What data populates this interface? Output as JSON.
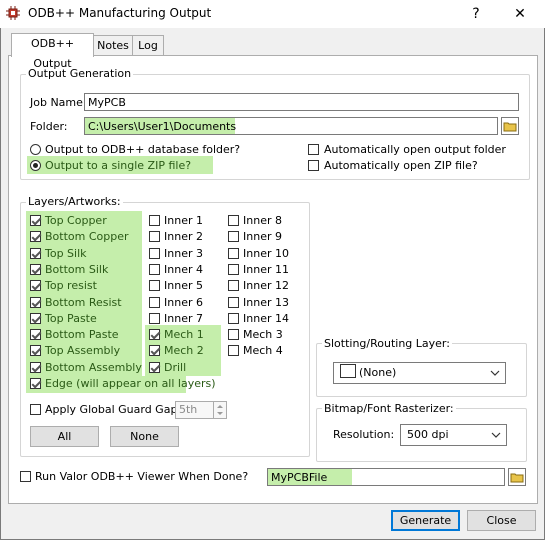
{
  "window": {
    "title": "ODB++ Manufacturing Output",
    "help_label": "?",
    "close_label": "✕"
  },
  "tabs": [
    {
      "label": "ODB++ Output",
      "active": true
    },
    {
      "label": "Notes"
    },
    {
      "label": "Log"
    }
  ],
  "output_generation": {
    "group_label": "Output Generation",
    "job_name_label": "Job Name:",
    "job_name_value": "MyPCB",
    "folder_label": "Folder:",
    "folder_value": "C:\\Users\\User1\\Documents",
    "radio_database": "Output to ODB++ database folder?",
    "radio_zip": "Output to a single ZIP file?",
    "auto_open_folder": "Automatically open output folder",
    "auto_open_zip": "Automatically open ZIP file?"
  },
  "layers": {
    "group_label": "Layers/Artworks:",
    "column1": [
      {
        "label": "Top Copper",
        "checked": true
      },
      {
        "label": "Bottom Copper",
        "checked": true
      },
      {
        "label": "Top Silk",
        "checked": true
      },
      {
        "label": "Bottom Silk",
        "checked": true
      },
      {
        "label": "Top resist",
        "checked": true
      },
      {
        "label": "Bottom Resist",
        "checked": true
      },
      {
        "label": "Top Paste",
        "checked": true
      },
      {
        "label": "Bottom Paste",
        "checked": true
      },
      {
        "label": "Top Assembly",
        "checked": true
      },
      {
        "label": "Bottom Assembly",
        "checked": true
      }
    ],
    "column2": [
      {
        "label": "Inner 1",
        "checked": false
      },
      {
        "label": "Inner 2",
        "checked": false
      },
      {
        "label": "Inner 3",
        "checked": false
      },
      {
        "label": "Inner 4",
        "checked": false
      },
      {
        "label": "Inner 5",
        "checked": false
      },
      {
        "label": "Inner 6",
        "checked": false
      },
      {
        "label": "Inner 7",
        "checked": false
      },
      {
        "label": "Mech 1",
        "checked": true
      },
      {
        "label": "Mech 2",
        "checked": true
      },
      {
        "label": "Drill",
        "checked": true
      }
    ],
    "column3": [
      {
        "label": "Inner 8",
        "checked": false
      },
      {
        "label": "Inner 9",
        "checked": false
      },
      {
        "label": "Inner 10",
        "checked": false
      },
      {
        "label": "Inner 11",
        "checked": false
      },
      {
        "label": "Inner 12",
        "checked": false
      },
      {
        "label": "Inner 13",
        "checked": false
      },
      {
        "label": "Inner 14",
        "checked": false
      },
      {
        "label": "Mech 3",
        "checked": false
      },
      {
        "label": "Mech 4",
        "checked": false
      }
    ],
    "edge_label": "Edge (will appear on all layers)",
    "guard_gap_label": "Apply Global Guard Gap",
    "guard_gap_value": "5th",
    "all_button": "All",
    "none_button": "None"
  },
  "slotting": {
    "group_label": "Slotting/Routing Layer:",
    "selected": "(None)"
  },
  "rasterizer": {
    "group_label": "Bitmap/Font Rasterizer:",
    "resolution_label": "Resolution:",
    "resolution_value": "500 dpi"
  },
  "viewer": {
    "label": "Run Valor ODB++ Viewer When Done?",
    "file_value": "MyPCBFile"
  },
  "footer": {
    "generate_button": "Generate",
    "close_button": "Close"
  },
  "colors": {
    "highlight": "#c5eeab",
    "accent": "#0078d7"
  }
}
